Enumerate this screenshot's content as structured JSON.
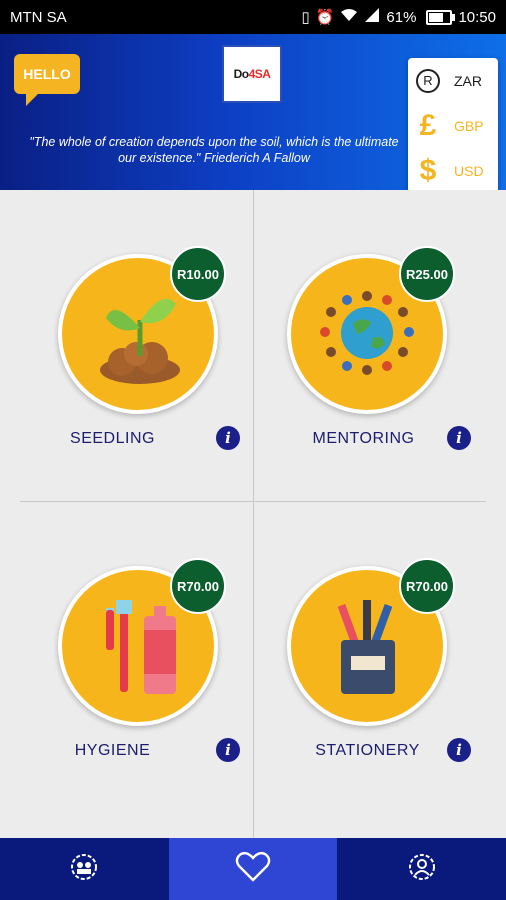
{
  "status_bar": {
    "carrier": "MTN SA",
    "battery": "61%",
    "time": "10:50",
    "signal": "4G",
    "battery_level": 0.61
  },
  "header": {
    "hello": "HELLO",
    "logo": {
      "part1": "Do",
      "part2": "4SA"
    },
    "quote_line1": "\"The whole of creation depends upon the soil, which is the ultimate",
    "quote_line2": "our existence.\" Friederich A Fallow"
  },
  "currencies": [
    {
      "symbol": "R",
      "code": "ZAR",
      "selected": true
    },
    {
      "symbol": "£",
      "code": "GBP",
      "selected": false
    },
    {
      "symbol": "$",
      "code": "USD",
      "selected": false
    }
  ],
  "items": [
    {
      "name": "SEEDLING",
      "price": "R10.00",
      "icon": "seedling-icon"
    },
    {
      "name": "MENTORING",
      "price": "R25.00",
      "icon": "globe-people-icon"
    },
    {
      "name": "HYGIENE",
      "price": "R70.00",
      "icon": "toothbrush-toothpaste-icon"
    },
    {
      "name": "STATIONERY",
      "price": "R70.00",
      "icon": "pencil-cup-icon"
    }
  ],
  "bottom_nav": [
    {
      "icon": "gear-people-icon",
      "active": false
    },
    {
      "icon": "heart-icon",
      "active": true
    },
    {
      "icon": "profile-gear-icon",
      "active": false
    }
  ],
  "colors": {
    "accent": "#f7b51c",
    "price_badge": "#0d5e2f",
    "nav": "#0a1a7c",
    "nav_active": "#2f46d4",
    "label": "#1d1d6e"
  }
}
